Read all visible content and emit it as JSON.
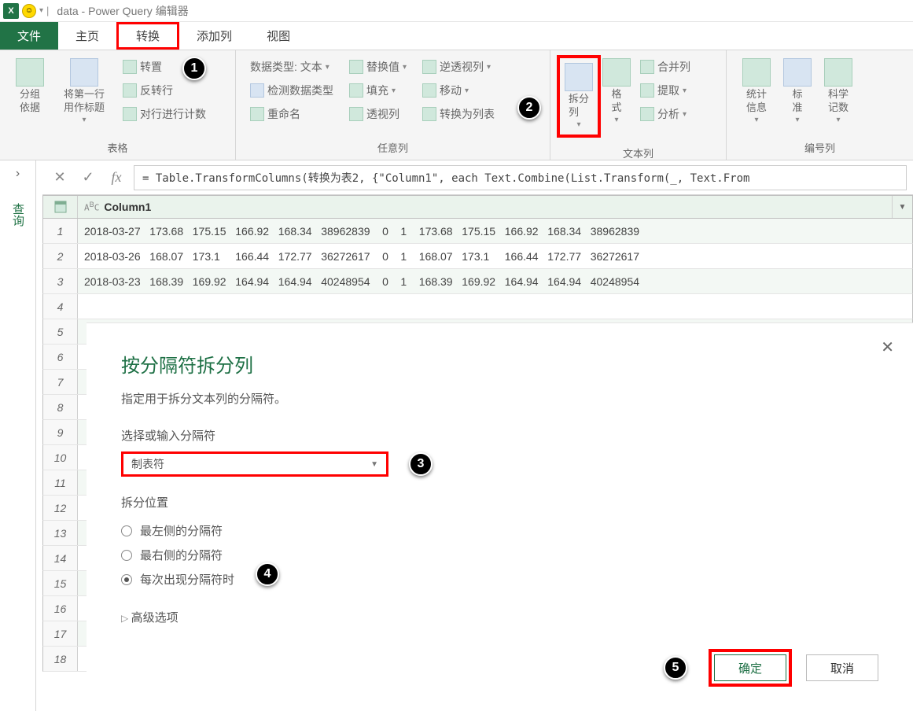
{
  "title_bar": {
    "title": "data - Power Query 编辑器"
  },
  "ribbon_tabs": {
    "file": "文件",
    "home": "主页",
    "transform": "转换",
    "add_col": "添加列",
    "view": "视图"
  },
  "ribbon": {
    "group_table": {
      "label": "表格",
      "group_by": "分组\n依据",
      "first_row": "将第一行\n用作标题",
      "transpose": "转置",
      "reverse": "反转行",
      "count_rows": "对行进行计数"
    },
    "group_any": {
      "label": "任意列",
      "data_type": "数据类型: 文本",
      "detect": "检测数据类型",
      "rename": "重命名",
      "replace": "替换值",
      "fill": "填充",
      "pivot": "透视列",
      "unpivot": "逆透视列",
      "move": "移动",
      "to_list": "转换为列表"
    },
    "group_text": {
      "label": "文本列",
      "split": "拆分\n列",
      "format": "格\n式",
      "merge": "合并列",
      "extract": "提取",
      "parse": "分析"
    },
    "group_num": {
      "label": "编号列",
      "stats": "统计\n信息",
      "standard": "标\n准",
      "scientific": "科学\n记数"
    }
  },
  "formula": "= Table.TransformColumns(转换为表2, {\"Column1\", each Text.Combine(List.Transform(_, Text.From",
  "side": {
    "label": "查询"
  },
  "grid": {
    "col_header": "Column1",
    "rows_data": [
      "2018-03-27   173.68   175.15   166.92   168.34   38962839    0    1    173.68   175.15   166.92   168.34   38962839",
      "2018-03-26   168.07   173.1     166.44   172.77   36272617    0    1    168.07   173.1     166.44   172.77   36272617",
      "2018-03-23   168.39   169.92   164.94   164.94   40248954    0    1    168.39   169.92   164.94   164.94   40248954"
    ],
    "row_numbers": [
      "1",
      "2",
      "3",
      "4",
      "5",
      "6",
      "7",
      "8",
      "9",
      "10",
      "11",
      "12",
      "13",
      "14",
      "15",
      "16",
      "17",
      "18"
    ]
  },
  "dialog": {
    "title": "按分隔符拆分列",
    "subtitle": "指定用于拆分文本列的分隔符。",
    "field_label": "选择或输入分隔符",
    "selected_delim": "制表符",
    "split_at_label": "拆分位置",
    "opt_left": "最左侧的分隔符",
    "opt_right": "最右侧的分隔符",
    "opt_each": "每次出现分隔符时",
    "advanced": "高级选项",
    "ok": "确定",
    "cancel": "取消"
  },
  "callouts": {
    "c1": "1",
    "c2": "2",
    "c3": "3",
    "c4": "4",
    "c5": "5"
  },
  "chart_data": null
}
